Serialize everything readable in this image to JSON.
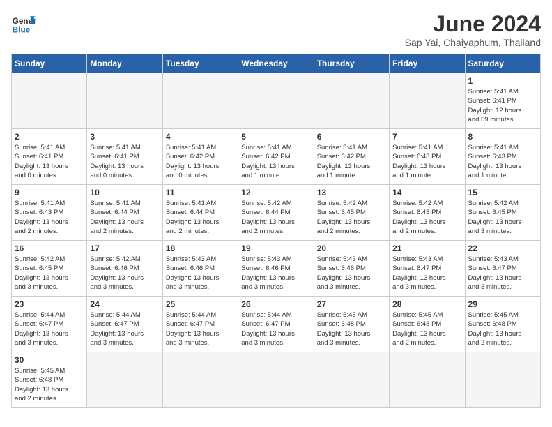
{
  "header": {
    "logo_line1": "General",
    "logo_line2": "Blue",
    "title": "June 2024",
    "subtitle": "Sap Yai, Chaiyaphum, Thailand"
  },
  "weekdays": [
    "Sunday",
    "Monday",
    "Tuesday",
    "Wednesday",
    "Thursday",
    "Friday",
    "Saturday"
  ],
  "weeks": [
    [
      {
        "day": "",
        "info": "",
        "empty": true
      },
      {
        "day": "",
        "info": "",
        "empty": true
      },
      {
        "day": "",
        "info": "",
        "empty": true
      },
      {
        "day": "",
        "info": "",
        "empty": true
      },
      {
        "day": "",
        "info": "",
        "empty": true
      },
      {
        "day": "",
        "info": "",
        "empty": true
      },
      {
        "day": "1",
        "info": "Sunrise: 5:41 AM\nSunset: 6:41 PM\nDaylight: 12 hours\nand 59 minutes."
      }
    ],
    [
      {
        "day": "2",
        "info": "Sunrise: 5:41 AM\nSunset: 6:41 PM\nDaylight: 13 hours\nand 0 minutes."
      },
      {
        "day": "3",
        "info": "Sunrise: 5:41 AM\nSunset: 6:41 PM\nDaylight: 13 hours\nand 0 minutes."
      },
      {
        "day": "4",
        "info": "Sunrise: 5:41 AM\nSunset: 6:42 PM\nDaylight: 13 hours\nand 0 minutes."
      },
      {
        "day": "5",
        "info": "Sunrise: 5:41 AM\nSunset: 6:42 PM\nDaylight: 13 hours\nand 1 minute."
      },
      {
        "day": "6",
        "info": "Sunrise: 5:41 AM\nSunset: 6:42 PM\nDaylight: 13 hours\nand 1 minute."
      },
      {
        "day": "7",
        "info": "Sunrise: 5:41 AM\nSunset: 6:43 PM\nDaylight: 13 hours\nand 1 minute."
      },
      {
        "day": "8",
        "info": "Sunrise: 5:41 AM\nSunset: 6:43 PM\nDaylight: 13 hours\nand 1 minute."
      }
    ],
    [
      {
        "day": "9",
        "info": "Sunrise: 5:41 AM\nSunset: 6:43 PM\nDaylight: 13 hours\nand 2 minutes."
      },
      {
        "day": "10",
        "info": "Sunrise: 5:41 AM\nSunset: 6:44 PM\nDaylight: 13 hours\nand 2 minutes."
      },
      {
        "day": "11",
        "info": "Sunrise: 5:41 AM\nSunset: 6:44 PM\nDaylight: 13 hours\nand 2 minutes."
      },
      {
        "day": "12",
        "info": "Sunrise: 5:42 AM\nSunset: 6:44 PM\nDaylight: 13 hours\nand 2 minutes."
      },
      {
        "day": "13",
        "info": "Sunrise: 5:42 AM\nSunset: 6:45 PM\nDaylight: 13 hours\nand 2 minutes."
      },
      {
        "day": "14",
        "info": "Sunrise: 5:42 AM\nSunset: 6:45 PM\nDaylight: 13 hours\nand 2 minutes."
      },
      {
        "day": "15",
        "info": "Sunrise: 5:42 AM\nSunset: 6:45 PM\nDaylight: 13 hours\nand 3 minutes."
      }
    ],
    [
      {
        "day": "16",
        "info": "Sunrise: 5:42 AM\nSunset: 6:45 PM\nDaylight: 13 hours\nand 3 minutes."
      },
      {
        "day": "17",
        "info": "Sunrise: 5:42 AM\nSunset: 6:46 PM\nDaylight: 13 hours\nand 3 minutes."
      },
      {
        "day": "18",
        "info": "Sunrise: 5:43 AM\nSunset: 6:46 PM\nDaylight: 13 hours\nand 3 minutes."
      },
      {
        "day": "19",
        "info": "Sunrise: 5:43 AM\nSunset: 6:46 PM\nDaylight: 13 hours\nand 3 minutes."
      },
      {
        "day": "20",
        "info": "Sunrise: 5:43 AM\nSunset: 6:46 PM\nDaylight: 13 hours\nand 3 minutes."
      },
      {
        "day": "21",
        "info": "Sunrise: 5:43 AM\nSunset: 6:47 PM\nDaylight: 13 hours\nand 3 minutes."
      },
      {
        "day": "22",
        "info": "Sunrise: 5:43 AM\nSunset: 6:47 PM\nDaylight: 13 hours\nand 3 minutes."
      }
    ],
    [
      {
        "day": "23",
        "info": "Sunrise: 5:44 AM\nSunset: 6:47 PM\nDaylight: 13 hours\nand 3 minutes."
      },
      {
        "day": "24",
        "info": "Sunrise: 5:44 AM\nSunset: 6:47 PM\nDaylight: 13 hours\nand 3 minutes."
      },
      {
        "day": "25",
        "info": "Sunrise: 5:44 AM\nSunset: 6:47 PM\nDaylight: 13 hours\nand 3 minutes."
      },
      {
        "day": "26",
        "info": "Sunrise: 5:44 AM\nSunset: 6:47 PM\nDaylight: 13 hours\nand 3 minutes."
      },
      {
        "day": "27",
        "info": "Sunrise: 5:45 AM\nSunset: 6:48 PM\nDaylight: 13 hours\nand 3 minutes."
      },
      {
        "day": "28",
        "info": "Sunrise: 5:45 AM\nSunset: 6:48 PM\nDaylight: 13 hours\nand 2 minutes."
      },
      {
        "day": "29",
        "info": "Sunrise: 5:45 AM\nSunset: 6:48 PM\nDaylight: 13 hours\nand 2 minutes."
      }
    ],
    [
      {
        "day": "30",
        "info": "Sunrise: 5:45 AM\nSunset: 6:48 PM\nDaylight: 13 hours\nand 2 minutes."
      },
      {
        "day": "",
        "info": "",
        "empty": true
      },
      {
        "day": "",
        "info": "",
        "empty": true
      },
      {
        "day": "",
        "info": "",
        "empty": true
      },
      {
        "day": "",
        "info": "",
        "empty": true
      },
      {
        "day": "",
        "info": "",
        "empty": true
      },
      {
        "day": "",
        "info": "",
        "empty": true
      }
    ]
  ]
}
